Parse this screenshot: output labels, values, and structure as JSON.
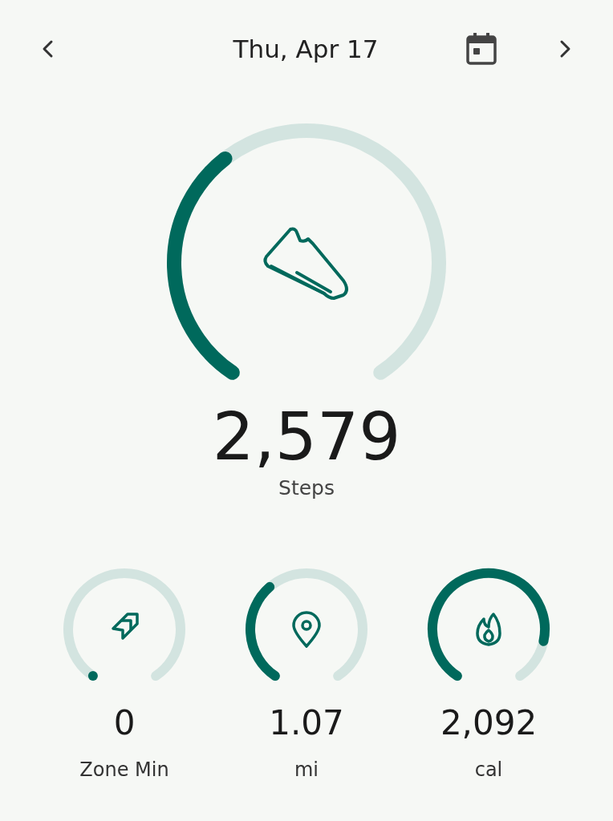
{
  "header": {
    "date": "Thu, Apr 17"
  },
  "main": {
    "kind": "steps",
    "value": "2,579",
    "label": "Steps"
  },
  "metrics": [
    {
      "kind": "zone",
      "value": "0",
      "label": "Zone Min"
    },
    {
      "kind": "distance",
      "value": "1.07",
      "label": "mi"
    },
    {
      "kind": "calories",
      "value": "2,092",
      "label": "cal"
    }
  ]
}
